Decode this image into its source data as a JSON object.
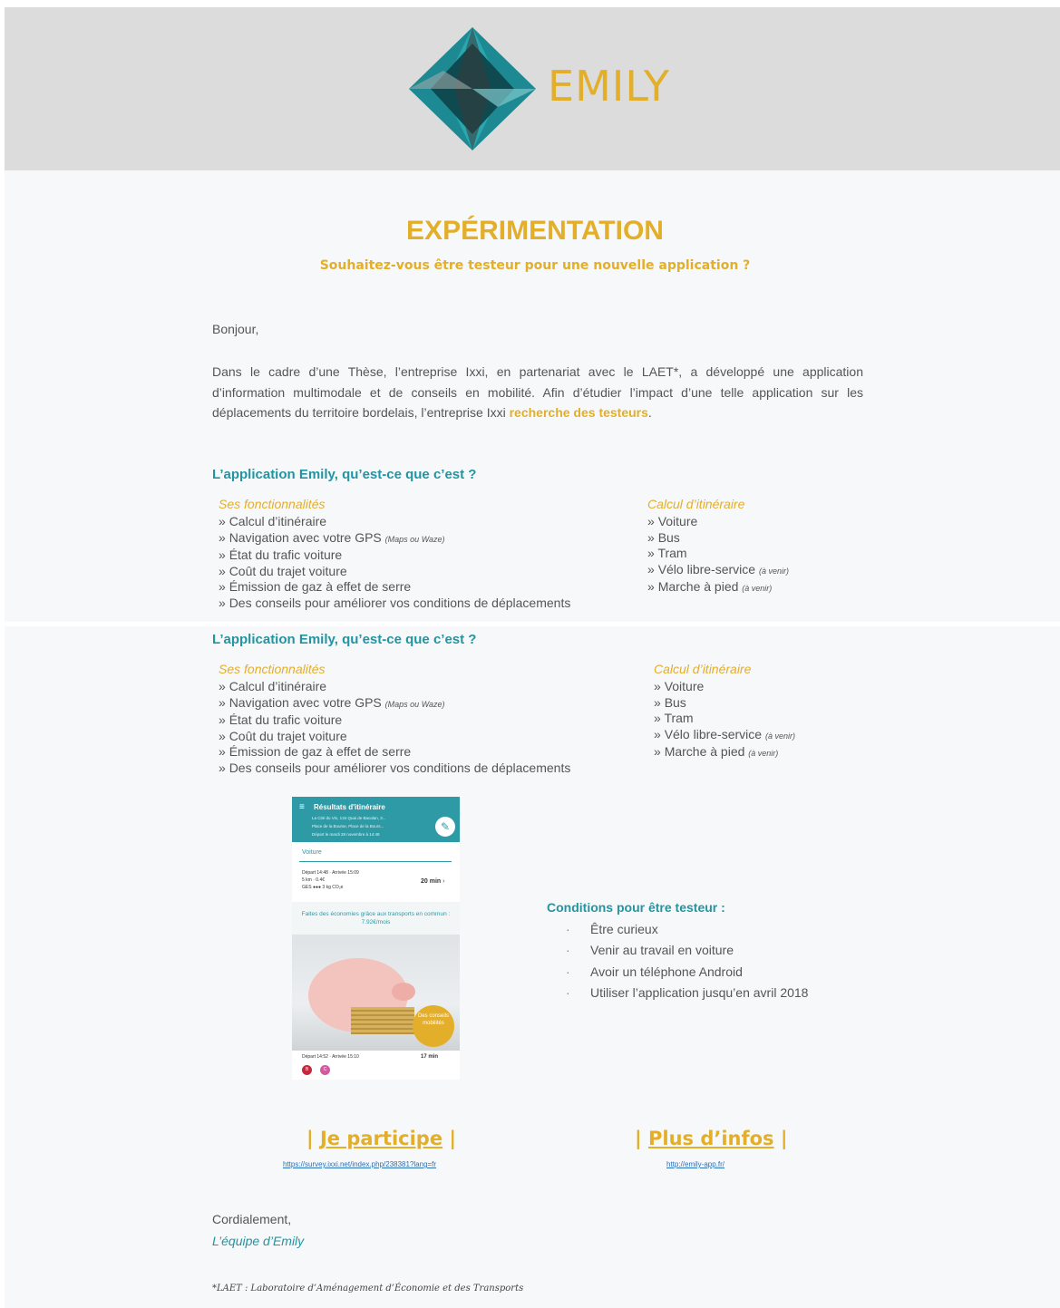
{
  "brand": {
    "name": "EMILY",
    "accent_color": "#e3ae2a",
    "teal_color": "#2394a2"
  },
  "heading": {
    "title": "EXPÉRIMENTATION",
    "subtitle": "Souhaitez-vous être testeur pour une nouvelle application ?"
  },
  "greeting": "Bonjour,",
  "intro": {
    "text": "Dans le cadre d’une Thèse, l’entreprise Ixxi, en partenariat avec le LAET*, a développé une application d’information multimodale et de conseils en mobilité. Afin d’étudier l’impact d’une telle application sur les déplacements du territoire bordelais, l’entreprise Ixxi ",
    "highlight": "recherche des testeurs",
    "end": "."
  },
  "section": {
    "title": "L’application Emily, qu’est-ce que c’est ?",
    "features_heading": "Ses fonctionnalités",
    "features": [
      {
        "label": "Calcul d’itinéraire",
        "note": ""
      },
      {
        "label": "Navigation avec votre GPS",
        "note": "(Maps ou Waze)"
      },
      {
        "label": "État du trafic voiture",
        "note": ""
      },
      {
        "label": "Coût du trajet voiture",
        "note": ""
      },
      {
        "label": "Émission de gaz à effet de serre",
        "note": ""
      },
      {
        "label": "Des conseils pour améliorer vos conditions de déplacements",
        "note": ""
      }
    ],
    "routes_heading": "Calcul d’itinéraire",
    "routes": [
      {
        "label": "Voiture",
        "note": ""
      },
      {
        "label": "Bus",
        "note": ""
      },
      {
        "label": "Tram",
        "note": ""
      },
      {
        "label": "Vélo libre-service",
        "note": "(à venir)"
      },
      {
        "label": "Marche à pied",
        "note": "(à venir)"
      }
    ],
    "bullet": "»"
  },
  "phone": {
    "menu_icon": "≡",
    "title": "Résultats d'itinéraire",
    "addresses": [
      "La Cité du Vin, 134 Quai de Bacalan, 3...",
      "Place de la Bourse, Place de la Bours...",
      "Départ le mardi 28 novembre à 14:48"
    ],
    "edit_icon": "✎",
    "mode": "Voiture",
    "departure": "Départ 14:48  · Arrivée 15:09",
    "distance_cost": "5 km · 0.4€",
    "ges": "GES ●●● 3 kg CO₂e",
    "duration": "20 min",
    "chevron": "›",
    "promo": "Faites des économies grâce aux transports en commun : 7.92€/mois",
    "badge": "Des conseils mobilités",
    "departure2": "Départ 14:52 · Arrivée 15:10",
    "duration2": "17 min",
    "line_b": "B",
    "line_c": "C"
  },
  "conditions": {
    "title": "Conditions pour être testeur :",
    "bullet": "·",
    "items": [
      "Être curieux",
      "Venir au travail en voiture",
      "Avoir un téléphone Android",
      "Utiliser l’application jusqu’en avril 2018"
    ]
  },
  "cta": {
    "participate": {
      "bar": "|",
      "label": "Je participe",
      "url": "https://survey.ixxi.net/index.php/238381?lang=fr"
    },
    "info": {
      "bar": "|",
      "label": "Plus d’infos",
      "url": "http://emily-app.fr/"
    }
  },
  "closing": "Cordialement,",
  "signature": "L’équipe d’Emily",
  "footnote": "*LAET : Laboratoire d’Aménagement d’Économie et des Transports"
}
